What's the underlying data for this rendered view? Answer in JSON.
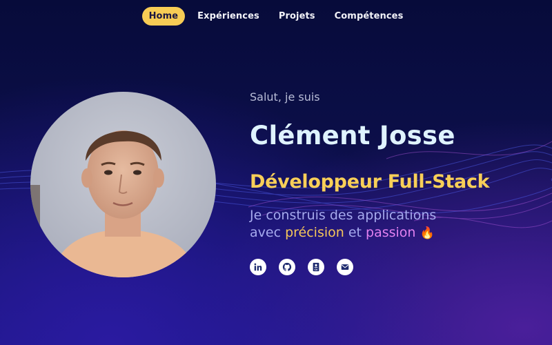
{
  "nav": {
    "items": [
      {
        "label": "Home",
        "active": true
      },
      {
        "label": "Expériences",
        "active": false
      },
      {
        "label": "Projets",
        "active": false
      },
      {
        "label": "Compétences",
        "active": false
      }
    ]
  },
  "hero": {
    "greeting": "Salut, je suis",
    "name": "Clément Josse",
    "role": "Développeur Full-Stack",
    "tagline_line1": "Je construis des applications",
    "tagline_avec": "avec",
    "tagline_word1": "précision",
    "tagline_et": "et",
    "tagline_word2": "passion",
    "tagline_emoji": "🔥"
  },
  "socials": [
    {
      "icon": "linkedin-icon"
    },
    {
      "icon": "github-icon"
    },
    {
      "icon": "cv-icon",
      "label": "CV"
    },
    {
      "icon": "mail-icon"
    }
  ],
  "colors": {
    "accent_yellow": "#f8cf58",
    "accent_pink": "#e281f0",
    "name_color": "#dff3ff",
    "background_dark": "#070b3a",
    "social_icon_color": "#1d2a6e"
  }
}
